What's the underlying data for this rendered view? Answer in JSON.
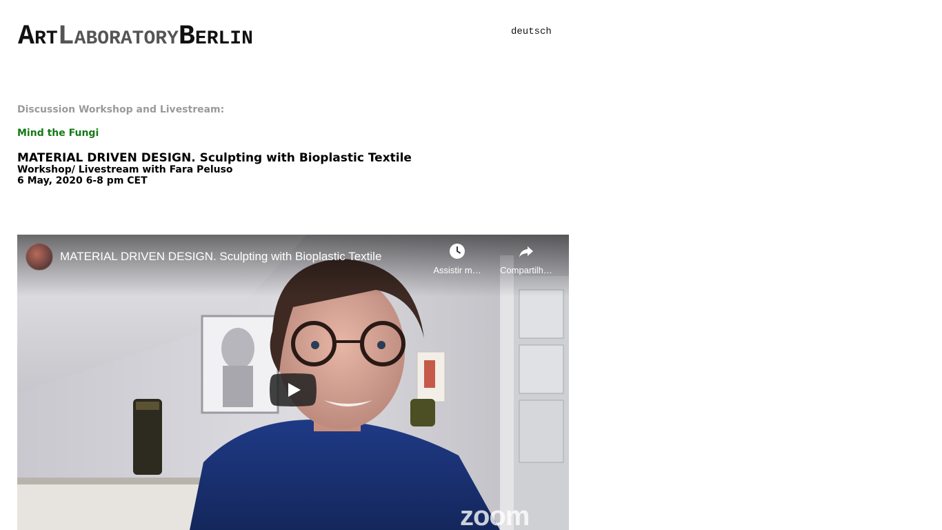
{
  "header": {
    "logo": {
      "parts": [
        {
          "cap": "A",
          "rest": "RT"
        },
        {
          "cap": "L",
          "rest": "ABORATORY"
        },
        {
          "cap": "B",
          "rest": "ERLIN"
        }
      ]
    },
    "language_link": "deutsch"
  },
  "article": {
    "kicker": "Discussion Workshop and Livestream:",
    "series": "Mind the Fungi",
    "title": "MATERIAL DRIVEN DESIGN. Sculpting with Bioplastic Textile",
    "subtitle": "Workshop/ Livestream with Fara Peluso",
    "date": "6 May, 2020 6-8 pm CET"
  },
  "video": {
    "title": "MATERIAL DRIVEN DESIGN. Sculpting with Bioplastic Textile",
    "watch_later_label": "Assistir m…",
    "share_label": "Compartilh…",
    "watermark": "zoom",
    "icons": {
      "channel": "channel-avatar",
      "watch_later": "clock-icon",
      "share": "share-arrow-icon",
      "play": "play-icon"
    }
  },
  "colors": {
    "kicker": "#9a9a9a",
    "series": "#137a13",
    "text": "#000000",
    "play_button": "#212121"
  }
}
